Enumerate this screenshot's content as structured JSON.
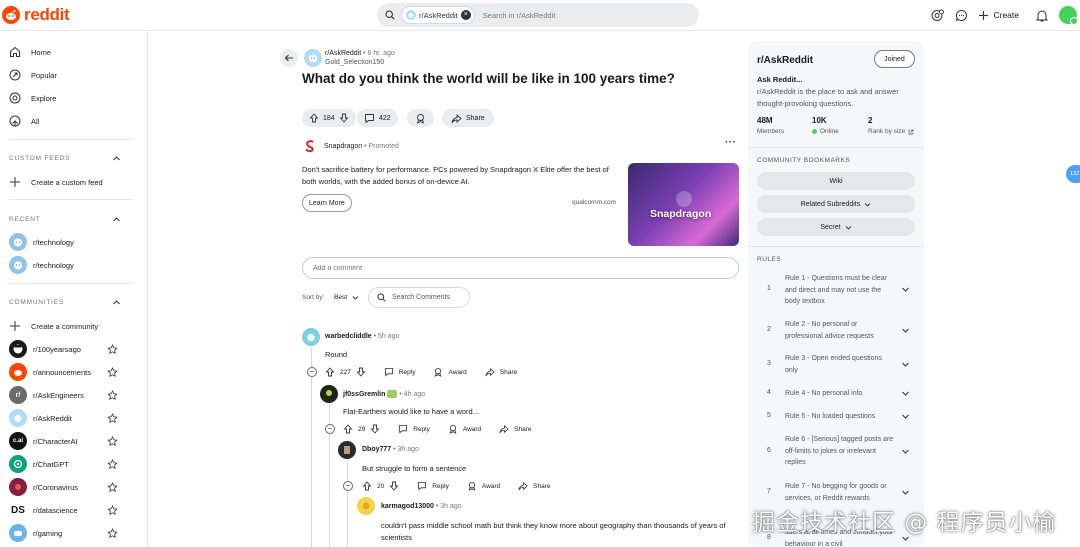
{
  "brand": {
    "name": "reddit",
    "color": "#ff4500"
  },
  "search": {
    "chip": "r/AskReddit",
    "placeholder": "Search in r/AskReddit"
  },
  "topbar": {
    "create": "Create"
  },
  "nav": [
    {
      "label": "Home",
      "icon": "home-icon"
    },
    {
      "label": "Popular",
      "icon": "popular-icon"
    },
    {
      "label": "Explore",
      "icon": "explore-icon"
    },
    {
      "label": "All",
      "icon": "all-icon"
    }
  ],
  "custom_feeds": {
    "title": "CUSTOM FEEDS",
    "create": "Create a custom feed"
  },
  "recent": {
    "title": "RECENT",
    "items": [
      "r/technology",
      "r/technology"
    ]
  },
  "communities": {
    "title": "COMMUNITIES",
    "create": "Create a community",
    "items": [
      {
        "name": "r/100yearsago",
        "glyph": "",
        "color": "#1a1a1b"
      },
      {
        "name": "r/announcements",
        "glyph": "",
        "color": "#ff4500"
      },
      {
        "name": "r/AskEngineers",
        "glyph": "r/",
        "color": "#6b6b6b"
      },
      {
        "name": "r/AskReddit",
        "glyph": "",
        "color": "#aeddf4"
      },
      {
        "name": "r/CharacterAI",
        "glyph": "c.ai",
        "color": "#111111"
      },
      {
        "name": "r/ChatGPT",
        "glyph": "",
        "color": "#10a37f"
      },
      {
        "name": "r/Coronavirus",
        "glyph": "",
        "color": "#8b1e3f"
      },
      {
        "name": "r/datascience",
        "glyph": "DS",
        "color": "#ffffff"
      },
      {
        "name": "r/gaming",
        "glyph": "",
        "color": "#6db3e6"
      }
    ]
  },
  "post": {
    "subreddit": "r/AskReddit",
    "time": "• 6 hr. ago",
    "author": "Gold_Selection150",
    "title": "What do you think the world will be like in 100 years time?",
    "votes": "184",
    "comments": "422",
    "share": "Share"
  },
  "ad": {
    "name": "Snapdragon",
    "promoted": "• Promoted",
    "text": "Don't sacrifice battery for performance. PCs powered by Snapdragon X Elite offer the best of both worlds, with the added bonus of on-device AI.",
    "cta": "Learn More",
    "domain": "qualcomm.com",
    "image_text": "Snapdragon"
  },
  "comment_box": {
    "placeholder": "Add a comment"
  },
  "sort": {
    "label": "Sort by:",
    "value": "Best",
    "search_placeholder": "Search Comments"
  },
  "comments": [
    {
      "author": "warbedcliddle",
      "time": "• 5h ago",
      "text": "Round",
      "votes": "227",
      "reply": "Reply",
      "award": "Award",
      "share": "Share"
    },
    {
      "author": "jf0ssGremlin",
      "time": "• 4h ago",
      "text": "Flat-Earthers would like to have a word...",
      "votes": "29",
      "reply": "Reply",
      "award": "Award",
      "share": "Share"
    },
    {
      "author": "Dboy777",
      "time": "• 3h ago",
      "text": "But struggle to form a sentence",
      "votes": "20",
      "reply": "Reply",
      "award": "Award",
      "share": "Share"
    },
    {
      "author": "karmagod13000",
      "time": "• 3h ago",
      "text": "couldn't pass middle school math but think they know more about geography than thousands of years of scientists"
    }
  ],
  "community": {
    "title": "r/AskReddit",
    "joined": "Joined",
    "subtitle": "Ask Reddit...",
    "description": "r/AskReddit is the place to ask and answer thought-provoking questions.",
    "stats": [
      {
        "value": "48M",
        "label": "Members"
      },
      {
        "value": "10K",
        "label": "Online"
      },
      {
        "value": "2",
        "label": "Rank by size"
      }
    ],
    "bookmarks_title": "COMMUNITY BOOKMARKS",
    "bookmarks": [
      "Wiki",
      "Related Subreddits",
      "Secret"
    ],
    "rules_title": "RULES",
    "rules": [
      {
        "n": "1",
        "text": "Rule 1 - Questions must be clear and direct and may not use the body textbox"
      },
      {
        "n": "2",
        "text": "Rule 2 - No personal or professional advice requests"
      },
      {
        "n": "3",
        "text": "Rule 3 - Open ended questions only"
      },
      {
        "n": "4",
        "text": "Rule 4 - No personal info"
      },
      {
        "n": "5",
        "text": "Rule 5 - No loaded questions"
      },
      {
        "n": "6",
        "text": "Rule 6 - [Serious] tagged posts are off-limits to jokes or irrelevant replies"
      },
      {
        "n": "7",
        "text": "Rule 7 - No begging for goods or services, or Reddit rewards"
      },
      {
        "n": "8",
        "text": "users at all times and conduct your behaviour in a civil"
      }
    ]
  },
  "badge": {
    "text": "132"
  },
  "watermark": "掘金技术社区 @ 程序员小榆"
}
